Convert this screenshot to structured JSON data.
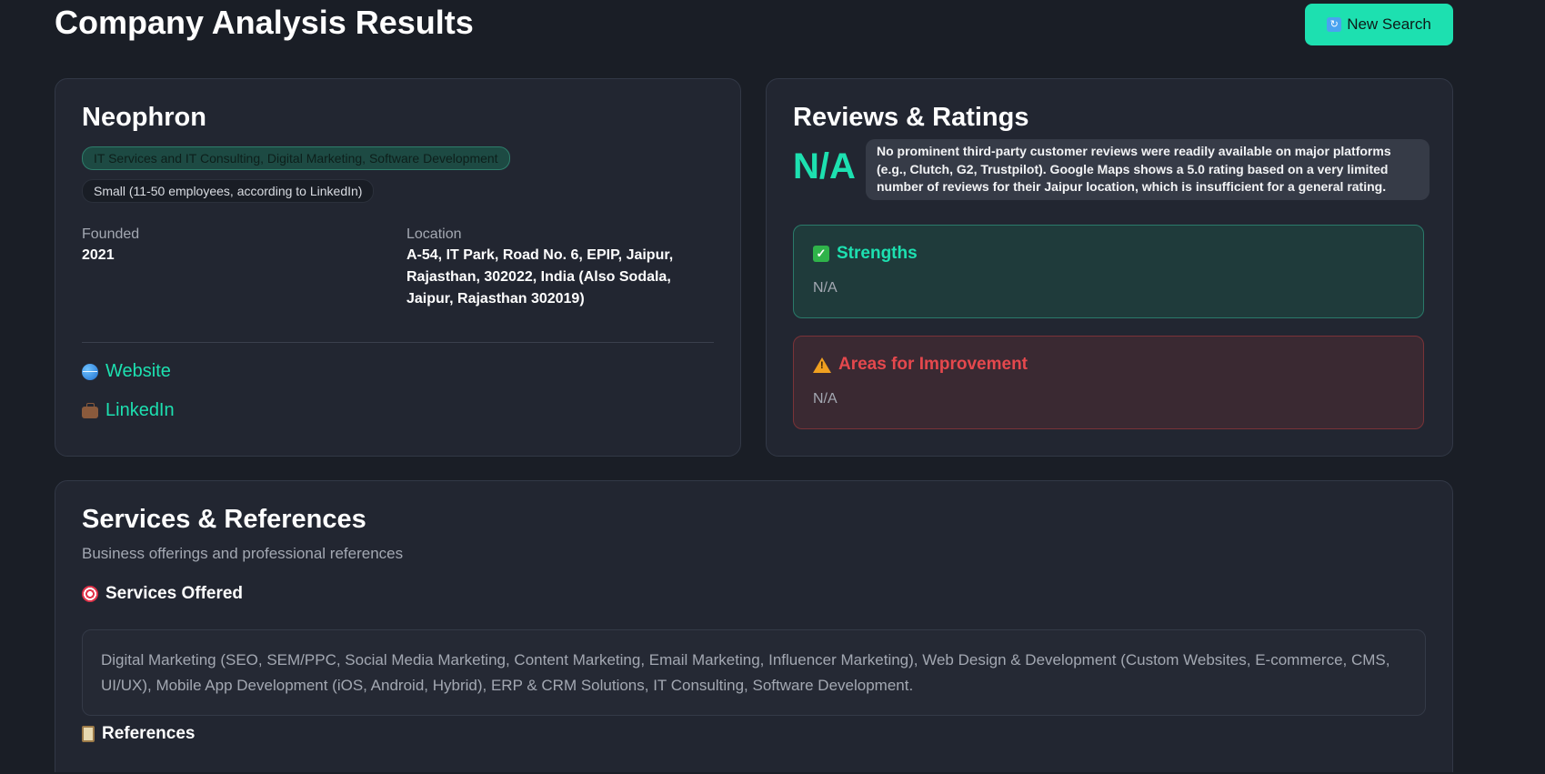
{
  "header": {
    "title": "Company Analysis Results",
    "new_search_label": "New Search",
    "new_search_icon": "refresh-icon"
  },
  "company": {
    "name": "Neophron",
    "industry": "IT Services and IT Consulting, Digital Marketing, Software Development",
    "size": "Small (11-50 employees, according to LinkedIn)",
    "founded_label": "Founded",
    "founded_value": "2021",
    "location_label": "Location",
    "location_value": "A-54, IT Park, Road No. 6, EPIP, Jaipur, Rajasthan, 302022, India (Also Sodala, Jaipur, Rajasthan 302019)",
    "website_label": "Website",
    "linkedin_label": "LinkedIn"
  },
  "reviews": {
    "title": "Reviews & Ratings",
    "rating": "N/A",
    "note": "No prominent third-party customer reviews were readily available on major platforms (e.g., Clutch, G2, Trustpilot). Google Maps shows a 5.0 rating based on a very limited number of reviews for their Jaipur location, which is insufficient for a general rating.",
    "strengths_title": "Strengths",
    "strengths_body": "N/A",
    "improvement_title": "Areas for Improvement",
    "improvement_body": "N/A"
  },
  "services": {
    "title": "Services & References",
    "subtitle": "Business offerings and professional references",
    "offered_heading": "Services Offered",
    "offered_text": "Digital Marketing (SEO, SEM/PPC, Social Media Marketing, Content Marketing, Email Marketing, Influencer Marketing), Web Design & Development (Custom Websites, E-commerce, CMS, UI/UX), Mobile App Development (iOS, Android, Hybrid), ERP & CRM Solutions, IT Consulting, Software Development.",
    "references_heading": "References"
  },
  "colors": {
    "accent": "#1de0b0",
    "background": "#1a1e26",
    "card": "#222631",
    "danger": "#e5484d"
  }
}
